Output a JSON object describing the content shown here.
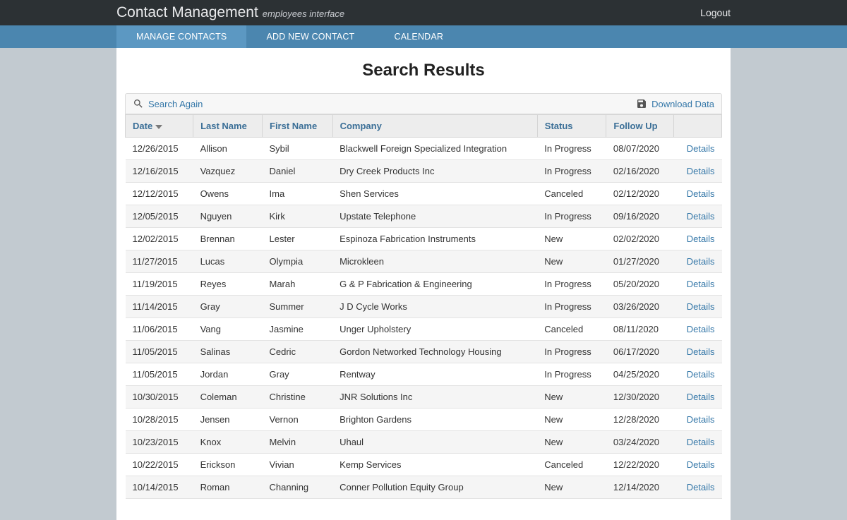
{
  "header": {
    "brand_title": "Contact Management",
    "brand_subtitle": "employees interface",
    "logout": "Logout"
  },
  "nav": {
    "tabs": [
      {
        "label": "MANAGE CONTACTS",
        "active": true
      },
      {
        "label": "ADD NEW CONTACT",
        "active": false
      },
      {
        "label": "CALENDAR",
        "active": false
      }
    ]
  },
  "page": {
    "title": "Search Results",
    "search_again": "Search Again",
    "download_data": "Download Data",
    "details_label": "Details"
  },
  "table": {
    "columns": [
      {
        "label": "Date",
        "sorted_desc": true
      },
      {
        "label": "Last Name"
      },
      {
        "label": "First Name"
      },
      {
        "label": "Company"
      },
      {
        "label": "Status"
      },
      {
        "label": "Follow Up"
      },
      {
        "label": ""
      }
    ],
    "rows": [
      {
        "date": "12/26/2015",
        "last": "Allison",
        "first": "Sybil",
        "company": "Blackwell Foreign Specialized Integration",
        "status": "In Progress",
        "followup": "08/07/2020"
      },
      {
        "date": "12/16/2015",
        "last": "Vazquez",
        "first": "Daniel",
        "company": "Dry Creek Products Inc",
        "status": "In Progress",
        "followup": "02/16/2020"
      },
      {
        "date": "12/12/2015",
        "last": "Owens",
        "first": "Ima",
        "company": "Shen Services",
        "status": "Canceled",
        "followup": "02/12/2020"
      },
      {
        "date": "12/05/2015",
        "last": "Nguyen",
        "first": "Kirk",
        "company": "Upstate Telephone",
        "status": "In Progress",
        "followup": "09/16/2020"
      },
      {
        "date": "12/02/2015",
        "last": "Brennan",
        "first": "Lester",
        "company": "Espinoza Fabrication Instruments",
        "status": "New",
        "followup": "02/02/2020"
      },
      {
        "date": "11/27/2015",
        "last": "Lucas",
        "first": "Olympia",
        "company": "Microkleen",
        "status": "New",
        "followup": "01/27/2020"
      },
      {
        "date": "11/19/2015",
        "last": "Reyes",
        "first": "Marah",
        "company": "G & P Fabrication & Engineering",
        "status": "In Progress",
        "followup": "05/20/2020"
      },
      {
        "date": "11/14/2015",
        "last": "Gray",
        "first": "Summer",
        "company": "J D Cycle Works",
        "status": "In Progress",
        "followup": "03/26/2020"
      },
      {
        "date": "11/06/2015",
        "last": "Vang",
        "first": "Jasmine",
        "company": "Unger Upholstery",
        "status": "Canceled",
        "followup": "08/11/2020"
      },
      {
        "date": "11/05/2015",
        "last": "Salinas",
        "first": "Cedric",
        "company": "Gordon Networked Technology Housing",
        "status": "In Progress",
        "followup": "06/17/2020"
      },
      {
        "date": "11/05/2015",
        "last": "Jordan",
        "first": "Gray",
        "company": "Rentway",
        "status": "In Progress",
        "followup": "04/25/2020"
      },
      {
        "date": "10/30/2015",
        "last": "Coleman",
        "first": "Christine",
        "company": "JNR Solutions Inc",
        "status": "New",
        "followup": "12/30/2020"
      },
      {
        "date": "10/28/2015",
        "last": "Jensen",
        "first": "Vernon",
        "company": "Brighton Gardens",
        "status": "New",
        "followup": "12/28/2020"
      },
      {
        "date": "10/23/2015",
        "last": "Knox",
        "first": "Melvin",
        "company": "Uhaul",
        "status": "New",
        "followup": "03/24/2020"
      },
      {
        "date": "10/22/2015",
        "last": "Erickson",
        "first": "Vivian",
        "company": "Kemp Services",
        "status": "Canceled",
        "followup": "12/22/2020"
      },
      {
        "date": "10/14/2015",
        "last": "Roman",
        "first": "Channing",
        "company": "Conner Pollution Equity Group",
        "status": "New",
        "followup": "12/14/2020"
      }
    ]
  }
}
